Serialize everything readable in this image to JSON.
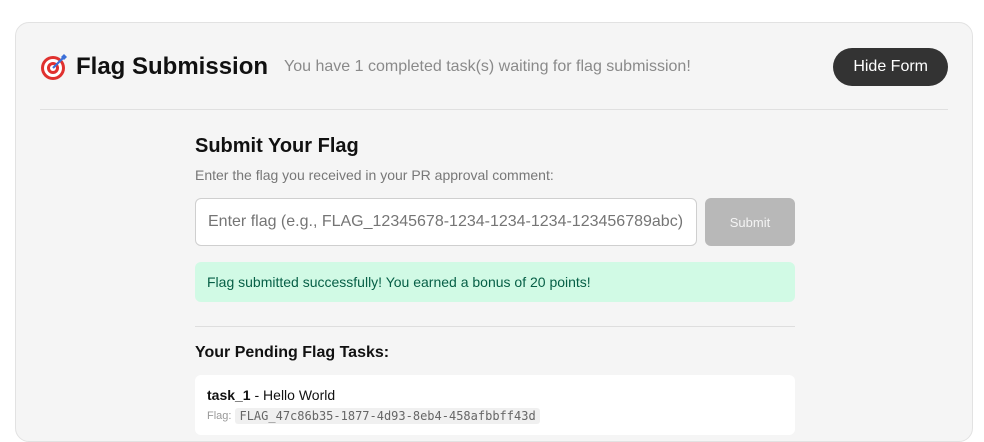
{
  "header": {
    "icon": "target-icon",
    "title": "Flag Submission",
    "subtitle": "You have 1 completed task(s) waiting for flag submission!",
    "hide_button_label": "Hide Form"
  },
  "form": {
    "title": "Submit Your Flag",
    "hint": "Enter the flag you received in your PR approval comment:",
    "input_value": "",
    "input_placeholder": "Enter flag (e.g., FLAG_12345678-1234-1234-1234-123456789abc)",
    "submit_label": "Submit",
    "submit_enabled": false
  },
  "success_message": "Flag submitted successfully! You earned a bonus of 20 points!",
  "pending": {
    "title": "Your Pending Flag Tasks:",
    "tasks": [
      {
        "id": "task_1",
        "separator": " - ",
        "name": "Hello World",
        "flag_label": "Flag:",
        "flag": "FLAG_47c86b35-1877-4d93-8eb4-458afbbff43d"
      }
    ]
  },
  "colors": {
    "card_bg": "#f5f5f5",
    "primary_button": "#333333",
    "disabled_button": "#b8b8b8",
    "success_bg": "#d1fae5",
    "success_text": "#065f46",
    "target_red": "#e0312f",
    "target_blue": "#3b6fd8"
  }
}
